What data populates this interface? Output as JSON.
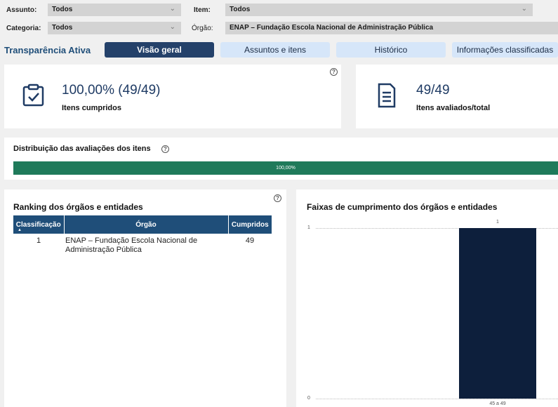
{
  "filters": {
    "assunto": {
      "label": "Assunto:",
      "value": "Todos"
    },
    "item": {
      "label": "Item:",
      "value": "Todos"
    },
    "categoria": {
      "label": "Categoria:",
      "value": "Todos"
    },
    "orgao": {
      "label": "Órgão:",
      "value": "ENAP – Fundação Escola Nacional de Administração Pública"
    }
  },
  "section_title": "Transparência Ativa",
  "tabs": [
    {
      "label": "Visão geral",
      "active": true
    },
    {
      "label": "Assuntos e itens",
      "active": false
    },
    {
      "label": "Histórico",
      "active": false
    },
    {
      "label": "Informações classificadas",
      "active": false
    }
  ],
  "kpis": {
    "cumpridos": {
      "value": "100,00% (49/49)",
      "label": "Itens cumpridos",
      "icon": "clipboard-check-icon"
    },
    "avaliados": {
      "value": "49/49",
      "label": "Itens avaliados/total",
      "icon": "document-list-icon"
    }
  },
  "distribution": {
    "title": "Distribuição das avaliações dos itens",
    "percent": 100,
    "percent_label": "100,00%",
    "color": "#1f7a5a"
  },
  "ranking": {
    "title": "Ranking dos órgãos e entidades",
    "columns": [
      "Classificação",
      "Órgão",
      "Cumpridos"
    ],
    "rows": [
      {
        "rank": "1",
        "orgao": "ENAP – Fundação Escola Nacional de Administração Pública",
        "cumpridos": "49"
      }
    ]
  },
  "help_icon": "?",
  "chart_data": {
    "type": "bar",
    "title": "Faixas de cumprimento dos órgãos e entidades",
    "categories": [
      "45 a 49"
    ],
    "values": [
      1
    ],
    "data_labels": [
      "1"
    ],
    "y_ticks": [
      "0",
      "1"
    ],
    "ylim": [
      0,
      1
    ],
    "xlabel": "",
    "ylabel": "",
    "bar_color": "#0d1f3c",
    "grid": true
  }
}
